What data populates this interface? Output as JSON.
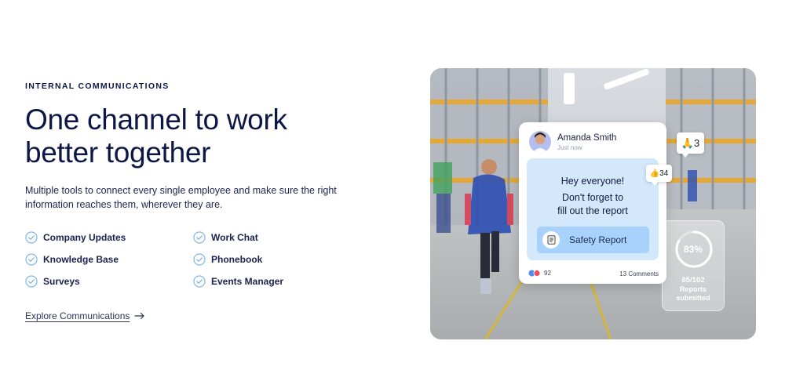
{
  "section": {
    "eyebrow": "INTERNAL COMMUNICATIONS",
    "headline_line1": "One channel to work",
    "headline_line2": "better together",
    "description": "Multiple tools to connect every single employee and make sure the right information reaches them, wherever they are."
  },
  "features": [
    {
      "label": "Company Updates",
      "icon": "check-circle-icon"
    },
    {
      "label": "Work Chat",
      "icon": "check-circle-icon"
    },
    {
      "label": "Knowledge Base",
      "icon": "check-circle-icon"
    },
    {
      "label": "Phonebook",
      "icon": "check-circle-icon"
    },
    {
      "label": "Surveys",
      "icon": "check-circle-icon"
    },
    {
      "label": "Events Manager",
      "icon": "check-circle-icon"
    }
  ],
  "cta": {
    "label": "Explore Communications",
    "icon": "arrow-right-icon"
  },
  "post_card": {
    "author": "Amanda Smith",
    "time": "Just now",
    "message_line1": "Hey everyone!",
    "message_line2": "Don't forget to",
    "message_line3": "fill out the report",
    "button_label": "Safety Report",
    "button_icon": "document-icon",
    "reactions_count": "92",
    "comments": "13 Comments"
  },
  "badges": {
    "thumbs_up": {
      "emoji": "👍",
      "count": "34"
    },
    "pray": {
      "emoji": "🙏",
      "count": "3"
    }
  },
  "stat": {
    "percent": "83%",
    "progress": 0.83,
    "fraction": "85/102",
    "label_line1": "Reports",
    "label_line2": "submitted"
  },
  "colors": {
    "navy": "#0d1747",
    "check": "#7fb6e6",
    "bubble": "#d3e8fb",
    "button": "#a8d2fb"
  }
}
